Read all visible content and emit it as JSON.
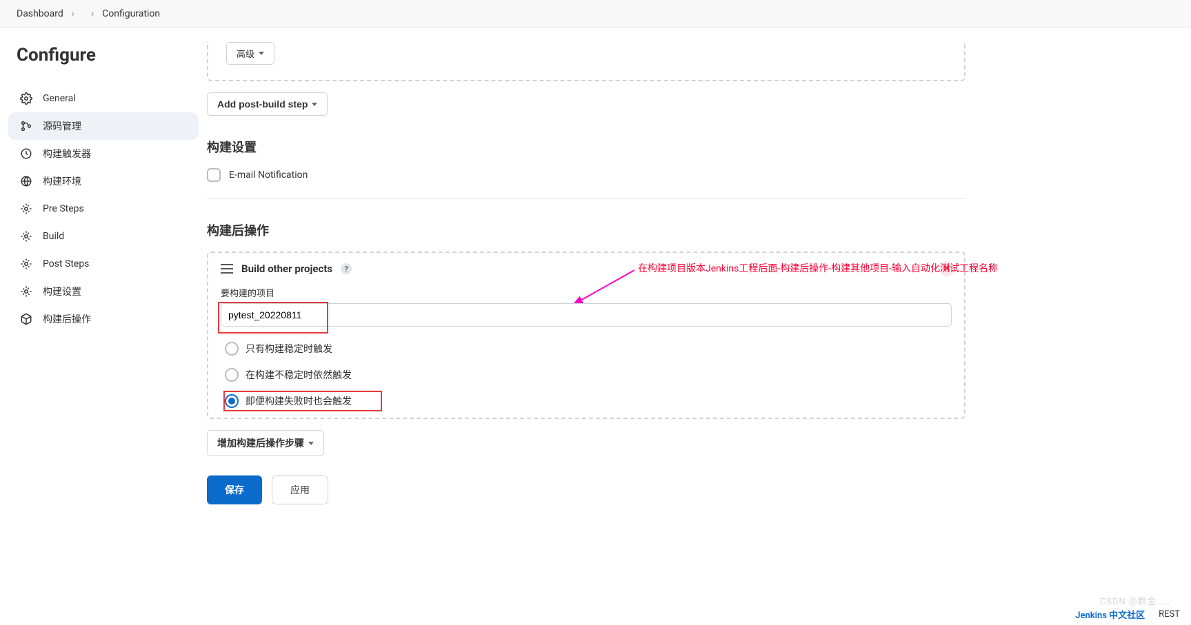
{
  "breadcrumb": {
    "items": [
      "Dashboard",
      "",
      "Configuration"
    ]
  },
  "page_title": "Configure",
  "sidebar": {
    "items": [
      {
        "label": "General"
      },
      {
        "label": "源码管理"
      },
      {
        "label": "构建触发器"
      },
      {
        "label": "构建环境"
      },
      {
        "label": "Pre Steps"
      },
      {
        "label": "Build"
      },
      {
        "label": "Post Steps"
      },
      {
        "label": "构建设置"
      },
      {
        "label": "构建后操作"
      }
    ]
  },
  "top_box": {
    "advanced_label": "高级",
    "add_step_label": "Add post-build step"
  },
  "build_settings": {
    "title": "构建设置",
    "email_label": "E-mail Notification"
  },
  "post_build": {
    "title": "构建后操作",
    "step_title": "Build other projects",
    "help_char": "?",
    "field_label": "要构建的项目",
    "field_value": "pytest_20220811",
    "radios": [
      "只有构建稳定时触发",
      "在构建不稳定时依然触发",
      "即便构建失败时也会触发"
    ],
    "annotation": "在构建项目版本Jenkins工程后面-构建后操作-构建其他项目-输入自动化测试工程名称",
    "add_step_label": "增加构建后操作步骤"
  },
  "buttons": {
    "save": "保存",
    "apply": "应用"
  },
  "footer": {
    "community": "Jenkins 中文社区",
    "rest": "REST"
  },
  "watermark": "CSDN @默金……"
}
